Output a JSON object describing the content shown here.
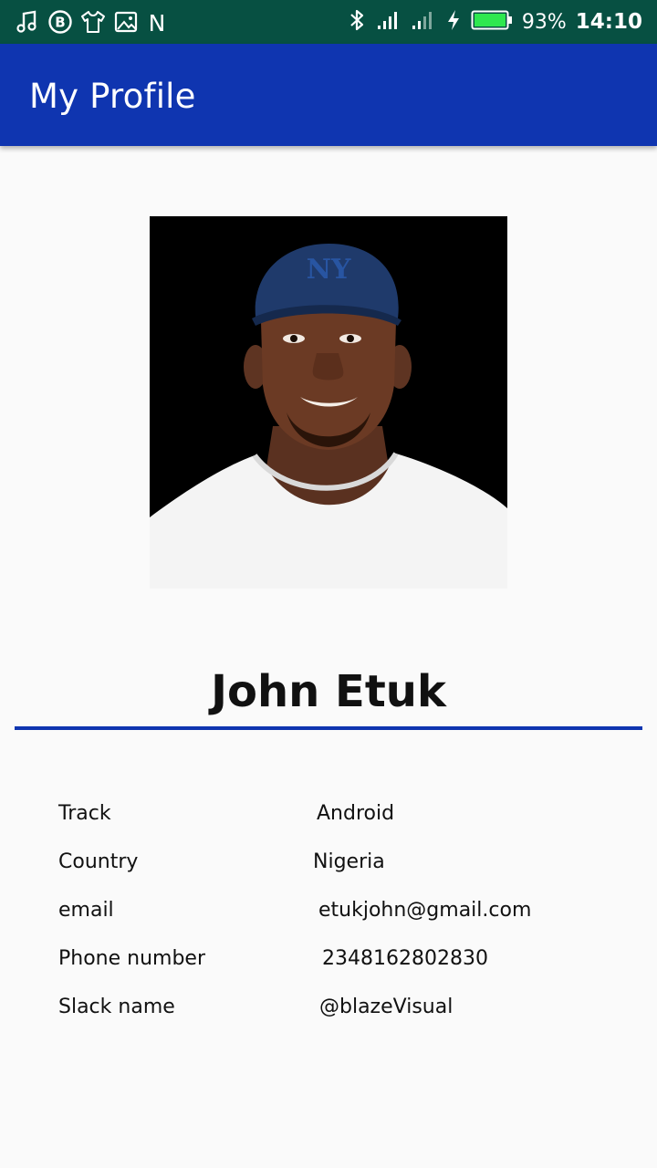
{
  "status_bar": {
    "battery_percent": "93%",
    "time": "14:10",
    "notification_icons": [
      "music-note-icon",
      "b-badge-icon",
      "shirt-icon",
      "image-icon",
      "n-letter-icon"
    ],
    "system_icons": [
      "bluetooth-icon",
      "signal-icon",
      "signal-weak-icon",
      "charging-bolt-icon",
      "battery-icon"
    ],
    "n_glyph": "N",
    "b_glyph": "B",
    "colors": {
      "background": "#075042",
      "battery_fill": "#2ee84f"
    }
  },
  "app_bar": {
    "title": "My Profile",
    "color": "#0f35b0"
  },
  "profile": {
    "name": "John Etuk",
    "accent_color": "#0f35b0",
    "fields": [
      {
        "label": "Track",
        "value": "Android"
      },
      {
        "label": "Country",
        "value": "Nigeria"
      },
      {
        "label": "email",
        "value": "etukjohn@gmail.com"
      },
      {
        "label": "Phone number",
        "value": "2348162802830"
      },
      {
        "label": "Slack name",
        "value": "@blazeVisual"
      }
    ]
  }
}
